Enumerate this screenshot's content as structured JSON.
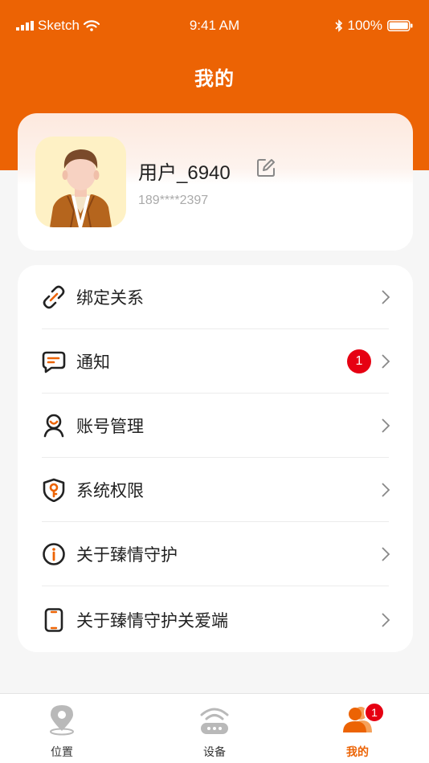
{
  "status_bar": {
    "carrier": "Sketch",
    "time": "9:41 AM",
    "battery": "100%"
  },
  "header": {
    "title": "我的"
  },
  "profile": {
    "username": "用户_6940",
    "phone": "189****2397"
  },
  "menu": {
    "items": [
      {
        "label": "绑定关系",
        "icon": "link-icon"
      },
      {
        "label": "通知",
        "icon": "message-icon",
        "badge": "1"
      },
      {
        "label": "账号管理",
        "icon": "account-icon"
      },
      {
        "label": "系统权限",
        "icon": "shield-key-icon"
      },
      {
        "label": "关于臻情守护",
        "icon": "info-icon"
      },
      {
        "label": "关于臻情守护关爱端",
        "icon": "phone-icon"
      }
    ]
  },
  "tabbar": {
    "tabs": [
      {
        "label": "位置",
        "icon": "location-pin-icon"
      },
      {
        "label": "设备",
        "icon": "device-icon"
      },
      {
        "label": "我的",
        "icon": "user-group-icon",
        "badge": "1",
        "active": true
      }
    ]
  },
  "colors": {
    "accent": "#ec6304",
    "badge": "#e60012",
    "background": "#f6f6f6"
  }
}
